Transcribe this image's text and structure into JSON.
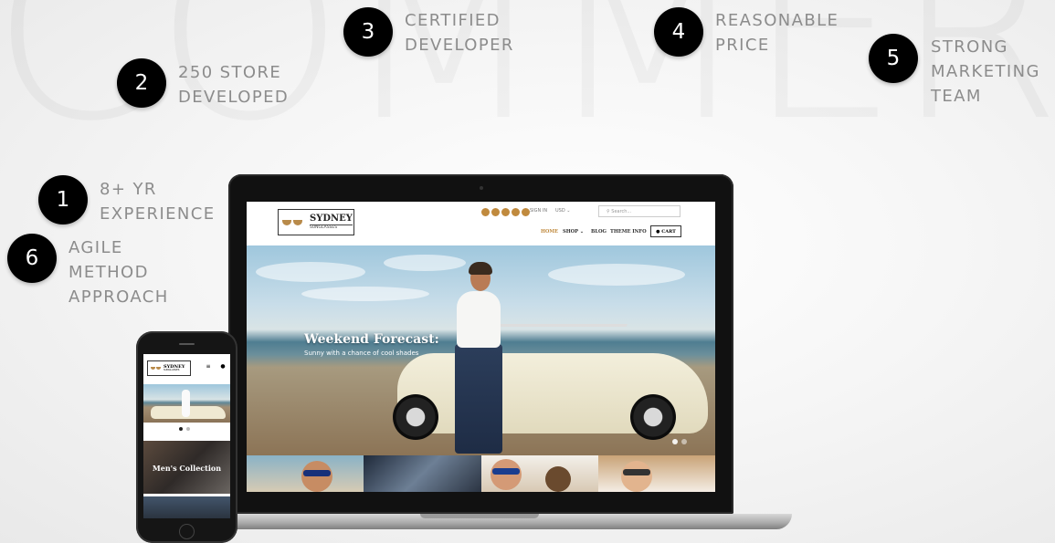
{
  "watermark": "COMMERCE",
  "features": [
    {
      "num": "1",
      "lines": [
        "8+ YR",
        "EXPERIENCE"
      ]
    },
    {
      "num": "2",
      "lines": [
        "250 STORE",
        "DEVELOPED"
      ]
    },
    {
      "num": "3",
      "lines": [
        "CERTIFIED",
        "DEVELOPER"
      ]
    },
    {
      "num": "4",
      "lines": [
        "REASONABLE",
        "PRICE"
      ]
    },
    {
      "num": "5",
      "lines": [
        "STRONG",
        "MARKETING",
        "TEAM"
      ]
    },
    {
      "num": "6",
      "lines": [
        "AGILE",
        "METHOD",
        "APPROACH"
      ]
    }
  ],
  "laptop_site": {
    "logo_line1": "SYDNEY",
    "logo_line2": "SUNGLASSES",
    "sign_in": "SIGN IN",
    "currency": "USD",
    "search_placeholder": "Search...",
    "nav": [
      "HOME",
      "SHOP",
      "BLOG",
      "THEME INFO"
    ],
    "cart": "CART",
    "hero_title": "Weekend Forecast:",
    "hero_subtitle": "Sunny with a chance of cool shades",
    "accent": "#c08a3e"
  },
  "phone_site": {
    "logo_line1": "SYDNEY",
    "logo_line2": "SUNGLASSES",
    "collection_label": "Men's Collection"
  }
}
